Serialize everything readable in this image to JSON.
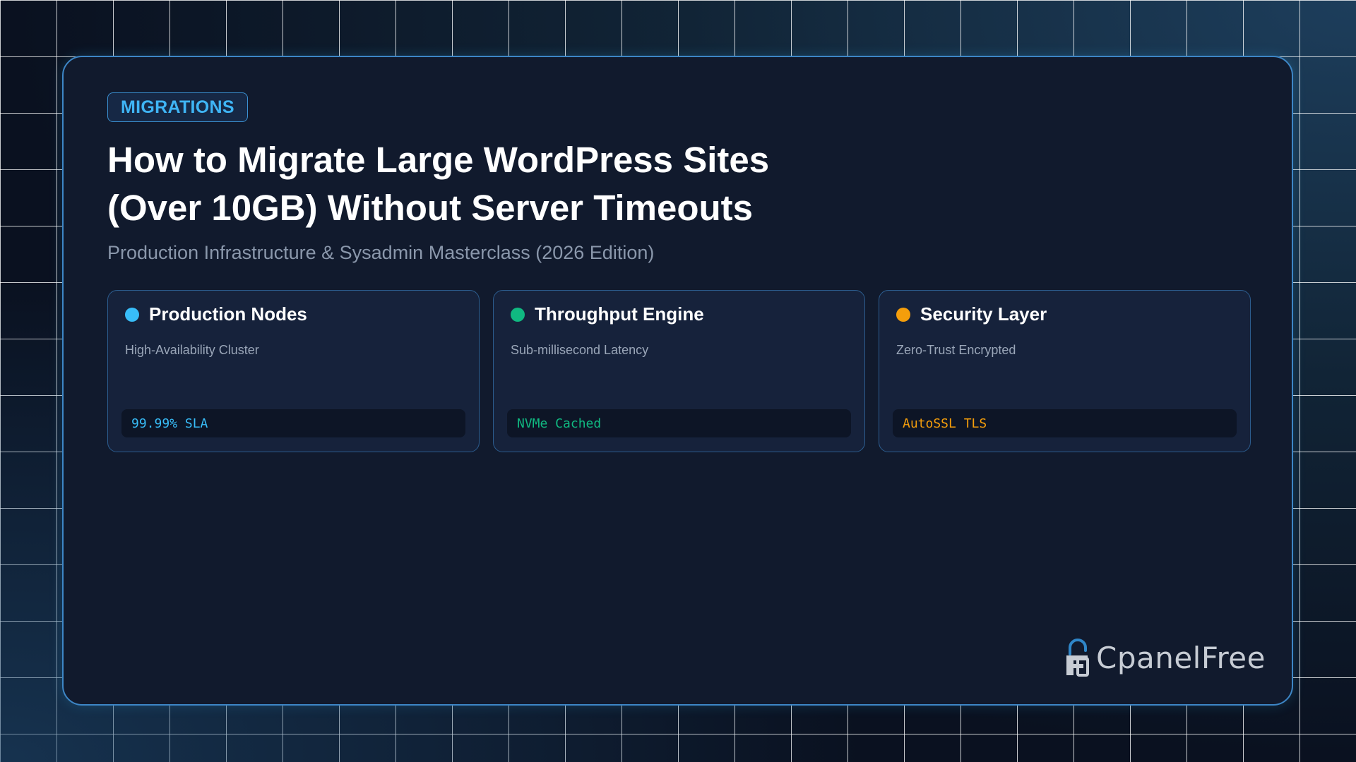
{
  "badge": {
    "label": "MIGRATIONS"
  },
  "title": {
    "line1": "How to Migrate Large WordPress Sites",
    "line2": "(Over 10GB) Without Server Timeouts"
  },
  "subtitle": "Production Infrastructure & Sysadmin Masterclass (2026 Edition)",
  "tiles": [
    {
      "title": "Production Nodes",
      "subtitle": "High-Availability Cluster",
      "tag": "99.99% SLA",
      "color": "#38bdf8",
      "dot_icon": "status-dot-icon"
    },
    {
      "title": "Throughput Engine",
      "subtitle": "Sub-millisecond Latency",
      "tag": "NVMe Cached",
      "color": "#10b981",
      "dot_icon": "status-dot-icon"
    },
    {
      "title": "Security Layer",
      "subtitle": "Zero-Trust Encrypted",
      "tag": "AutoSSL TLS",
      "color": "#f59e0b",
      "dot_icon": "status-dot-icon"
    }
  ],
  "brand": {
    "name": "CpanelFree",
    "icon": "padlock-logo-icon"
  },
  "colors": {
    "accent": "#3fb5f5",
    "card_border": "#3d86c6",
    "card_bg": "#111a2d",
    "page_bg": "#0a1120"
  }
}
